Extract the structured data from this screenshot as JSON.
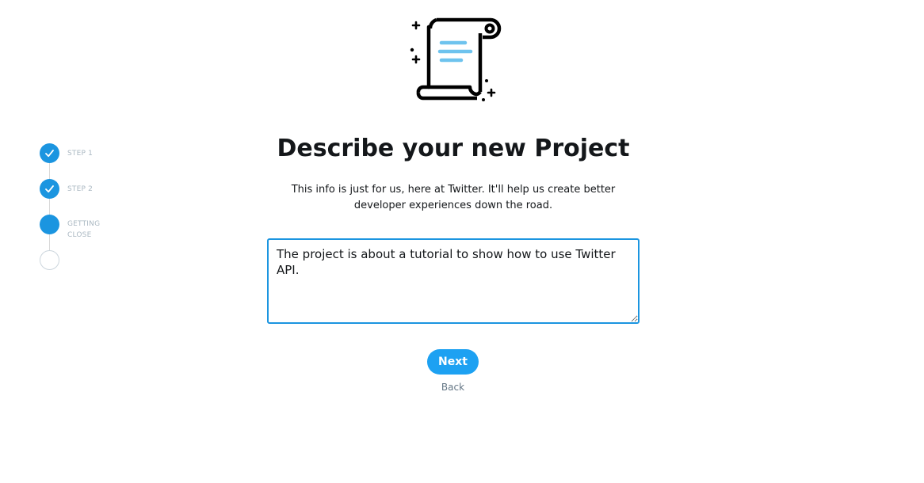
{
  "stepper": {
    "steps": [
      {
        "label": "STEP 1",
        "status": "complete",
        "icon": "checkmark-icon"
      },
      {
        "label": "STEP 2",
        "status": "complete",
        "icon": "checkmark-icon"
      },
      {
        "label": "GETTING CLOSE",
        "status": "current"
      },
      {
        "label": "",
        "status": "upcoming"
      }
    ]
  },
  "illustration": {
    "icon": "scroll-document-icon"
  },
  "main": {
    "title": "Describe your new Project",
    "subtitle": "This info is just for us, here at Twitter. It'll help us create better developer experiences down the road.",
    "description_value": "The project is about a tutorial to show how to use Twitter API.",
    "next_label": "Next",
    "back_label": "Back"
  },
  "colors": {
    "accent": "#1da1f2",
    "step_complete": "#1b95e0",
    "step_label": "#aab8c2",
    "muted_text": "#657786",
    "rail": "#d9d9d9"
  }
}
